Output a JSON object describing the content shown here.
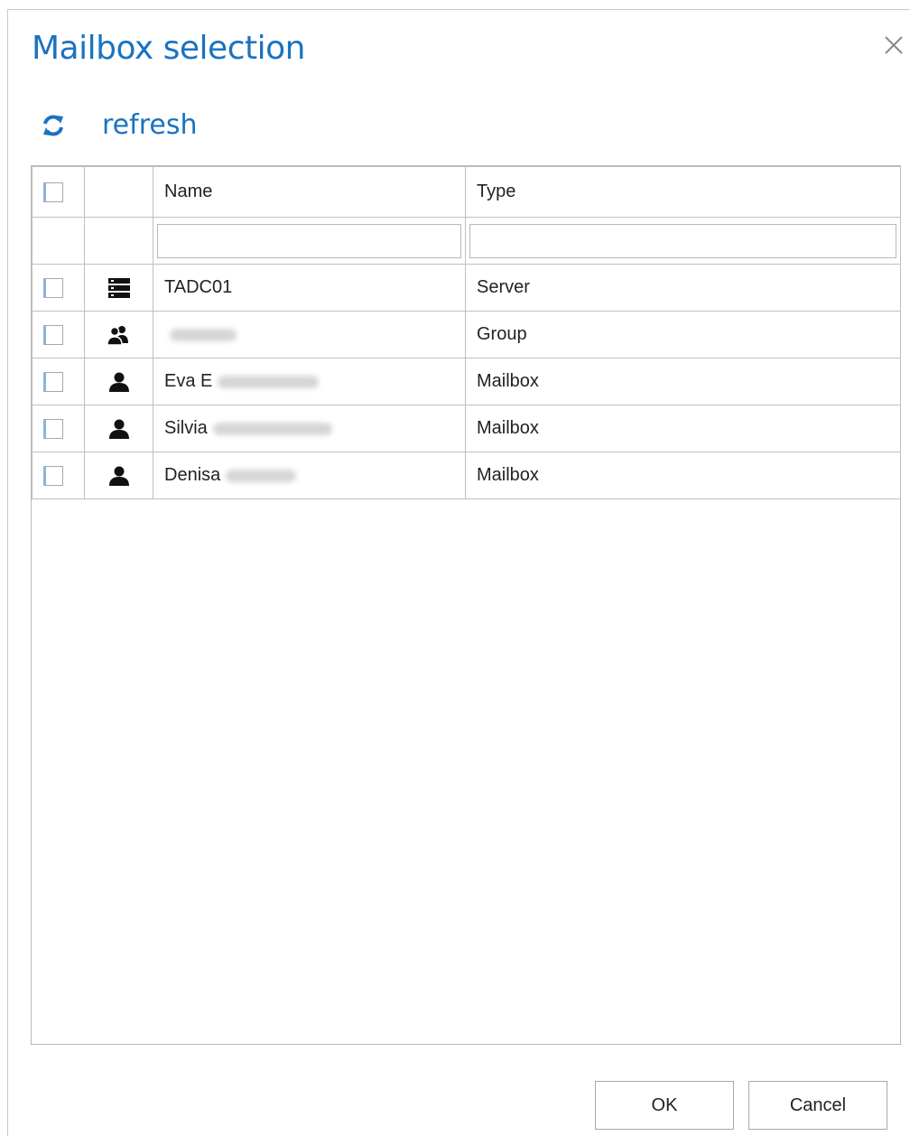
{
  "dialog": {
    "title": "Mailbox selection",
    "close_icon": "close-icon"
  },
  "toolbar": {
    "refresh_label": "refresh",
    "refresh_icon": "refresh-icon",
    "accent_color": "#1a73c0"
  },
  "grid": {
    "columns": [
      "",
      "",
      "Name",
      "Type"
    ],
    "filters": {
      "name_value": "",
      "type_value": ""
    },
    "rows": [
      {
        "icon": "server-icon",
        "name": "TADC01",
        "type": "Server",
        "checked": false
      },
      {
        "icon": "group-icon",
        "name": "",
        "type": "Group",
        "checked": false
      },
      {
        "icon": "user-icon",
        "name": "Eva E",
        "type": "Mailbox",
        "checked": false
      },
      {
        "icon": "user-icon",
        "name": "Silvia",
        "type": "Mailbox",
        "checked": false
      },
      {
        "icon": "user-icon",
        "name": "Denisa",
        "type": "Mailbox",
        "checked": false
      }
    ]
  },
  "footer": {
    "ok_label": "OK",
    "cancel_label": "Cancel"
  }
}
